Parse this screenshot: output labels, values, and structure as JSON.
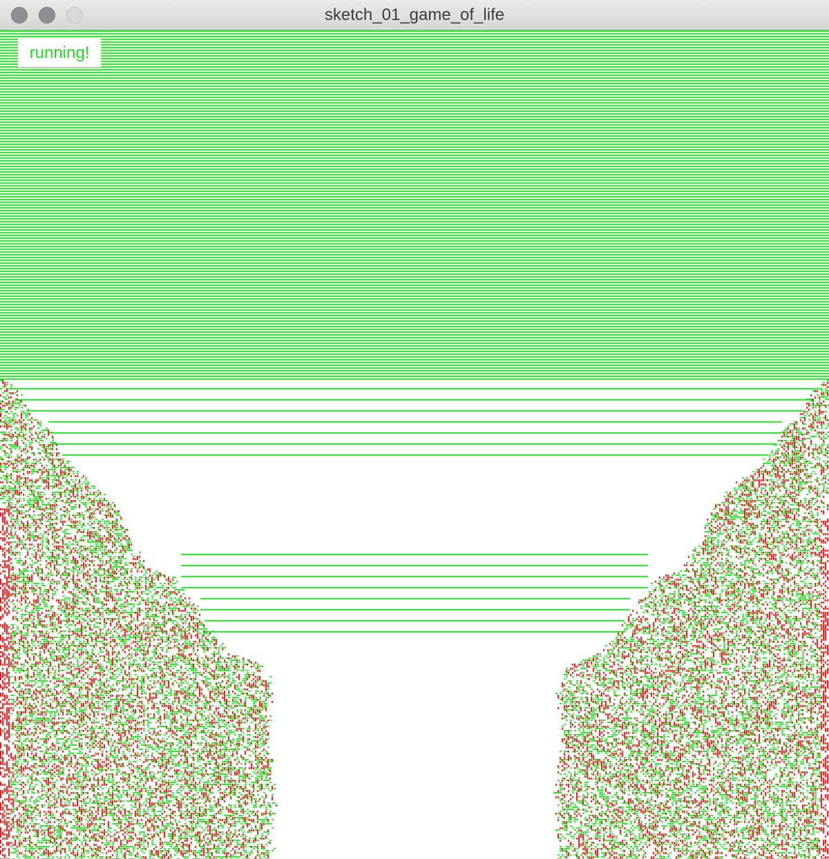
{
  "window": {
    "title": "sketch_01_game_of_life",
    "controls": [
      "close",
      "minimize",
      "zoom"
    ]
  },
  "sketch": {
    "status_text": "running!",
    "colors": {
      "stable_cell": "#22dd22",
      "unstable_cell": "#e01010",
      "background": "#ffffff",
      "status_text": "#22dd22"
    }
  }
}
